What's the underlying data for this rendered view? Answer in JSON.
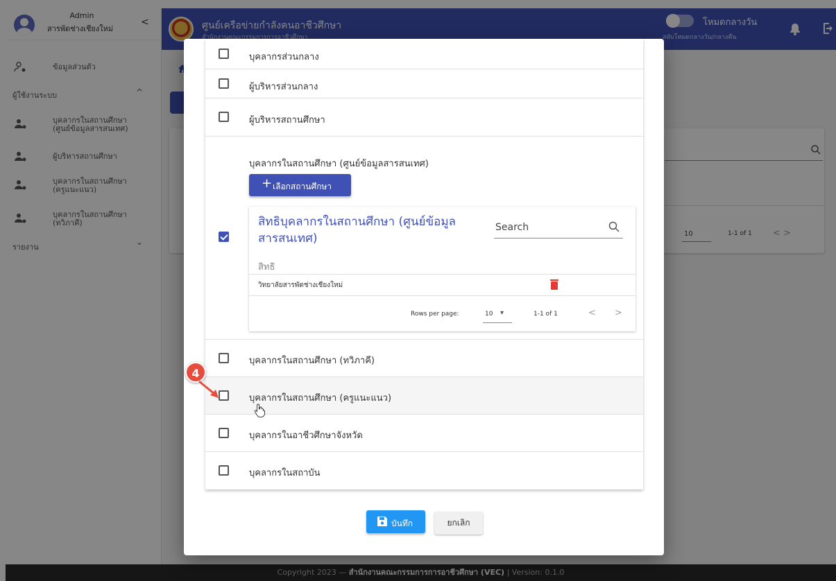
{
  "sidebar": {
    "user_name": "Admin",
    "college": "สารพัดช่างเชียงใหม่",
    "collapse": "<",
    "profile": "ข้อมูลส่วนตัว",
    "section_users": "ผู้ใช้งานระบบ",
    "section_users_caret": "^",
    "items": [
      {
        "label1": "บุคลากรในสถานศึกษา",
        "label2": "(ศูนย์ข้อมูลสารสนเทศ)"
      },
      {
        "label1": "ผู้บริหารสถานศึกษา",
        "label2": ""
      },
      {
        "label1": "บุคลากรในสถานศึกษา",
        "label2": "(ครูแนะแนว)"
      },
      {
        "label1": "บุคลากรในสถานศึกษา",
        "label2": "(ทวิภาคี)"
      }
    ],
    "section_report": "รายงาน",
    "section_report_caret": "⌄"
  },
  "header": {
    "title": "ศูนย์เครือข่ายกำลังคนอาชีวศึกษา",
    "subtitle": "สำนักงานคณะกรรมการการอาชีวศึกษา",
    "mode_label": "โหมดกลางวัน",
    "mode_hint": "สลับโหมดกลางวัน/กลางคืน"
  },
  "background": {
    "rows_per_page": "10",
    "range": "1-1 of 1",
    "nav": "<    >"
  },
  "dialog": {
    "rows": [
      {
        "label": "บุคลากรส่วนกลาง",
        "checked": false
      },
      {
        "label": "ผู้บริหารส่วนกลาง",
        "checked": false
      },
      {
        "label": "ผู้บริหารสถานศึกษา",
        "checked": false
      },
      {
        "label": "บุคลากรในสถานศึกษา (ทวิภาคี)",
        "checked": false
      },
      {
        "label": "บุคลากรในสถานศึกษา (ครูแนะแนว)",
        "checked": false
      },
      {
        "label": "บุคลากรในอาชีวศึกษาจังหวัด",
        "checked": false
      },
      {
        "label": "บุคลากรในสถาบัน",
        "checked": false
      }
    ],
    "expanded": {
      "title": "บุคลากรในสถานศึกษา (ศูนย์ข้อมูลสารสนเทศ)",
      "select_button": "เลือกสถานศึกษา",
      "checked": true,
      "card_title": "สิทธิบุคลากรในสถานศึกษา (ศูนย์ข้อมูลสารสนเทศ)",
      "search_placeholder": "Search",
      "column": "สิทธิ",
      "rows": [
        {
          "name": "วิทยาลัยสารพัดช่างเชียงใหม่"
        }
      ],
      "rows_per_page_label": "Rows per page:",
      "rows_per_page": "10",
      "range": "1-1 of 1"
    },
    "save_label": "บันทึก",
    "cancel_label": "ยกเลิก"
  },
  "annotation": {
    "step": "4"
  },
  "footer": {
    "prefix": "Copyright 2023 — ",
    "org": "สำนักงานคณะกรรมการการอาชีวศึกษา (VEC)",
    "suffix": " | Version: 0.1.0"
  },
  "colors": {
    "primary": "#3f51b5",
    "save": "#2196f3",
    "danger": "#e53935",
    "badge": "#e74c3c"
  }
}
